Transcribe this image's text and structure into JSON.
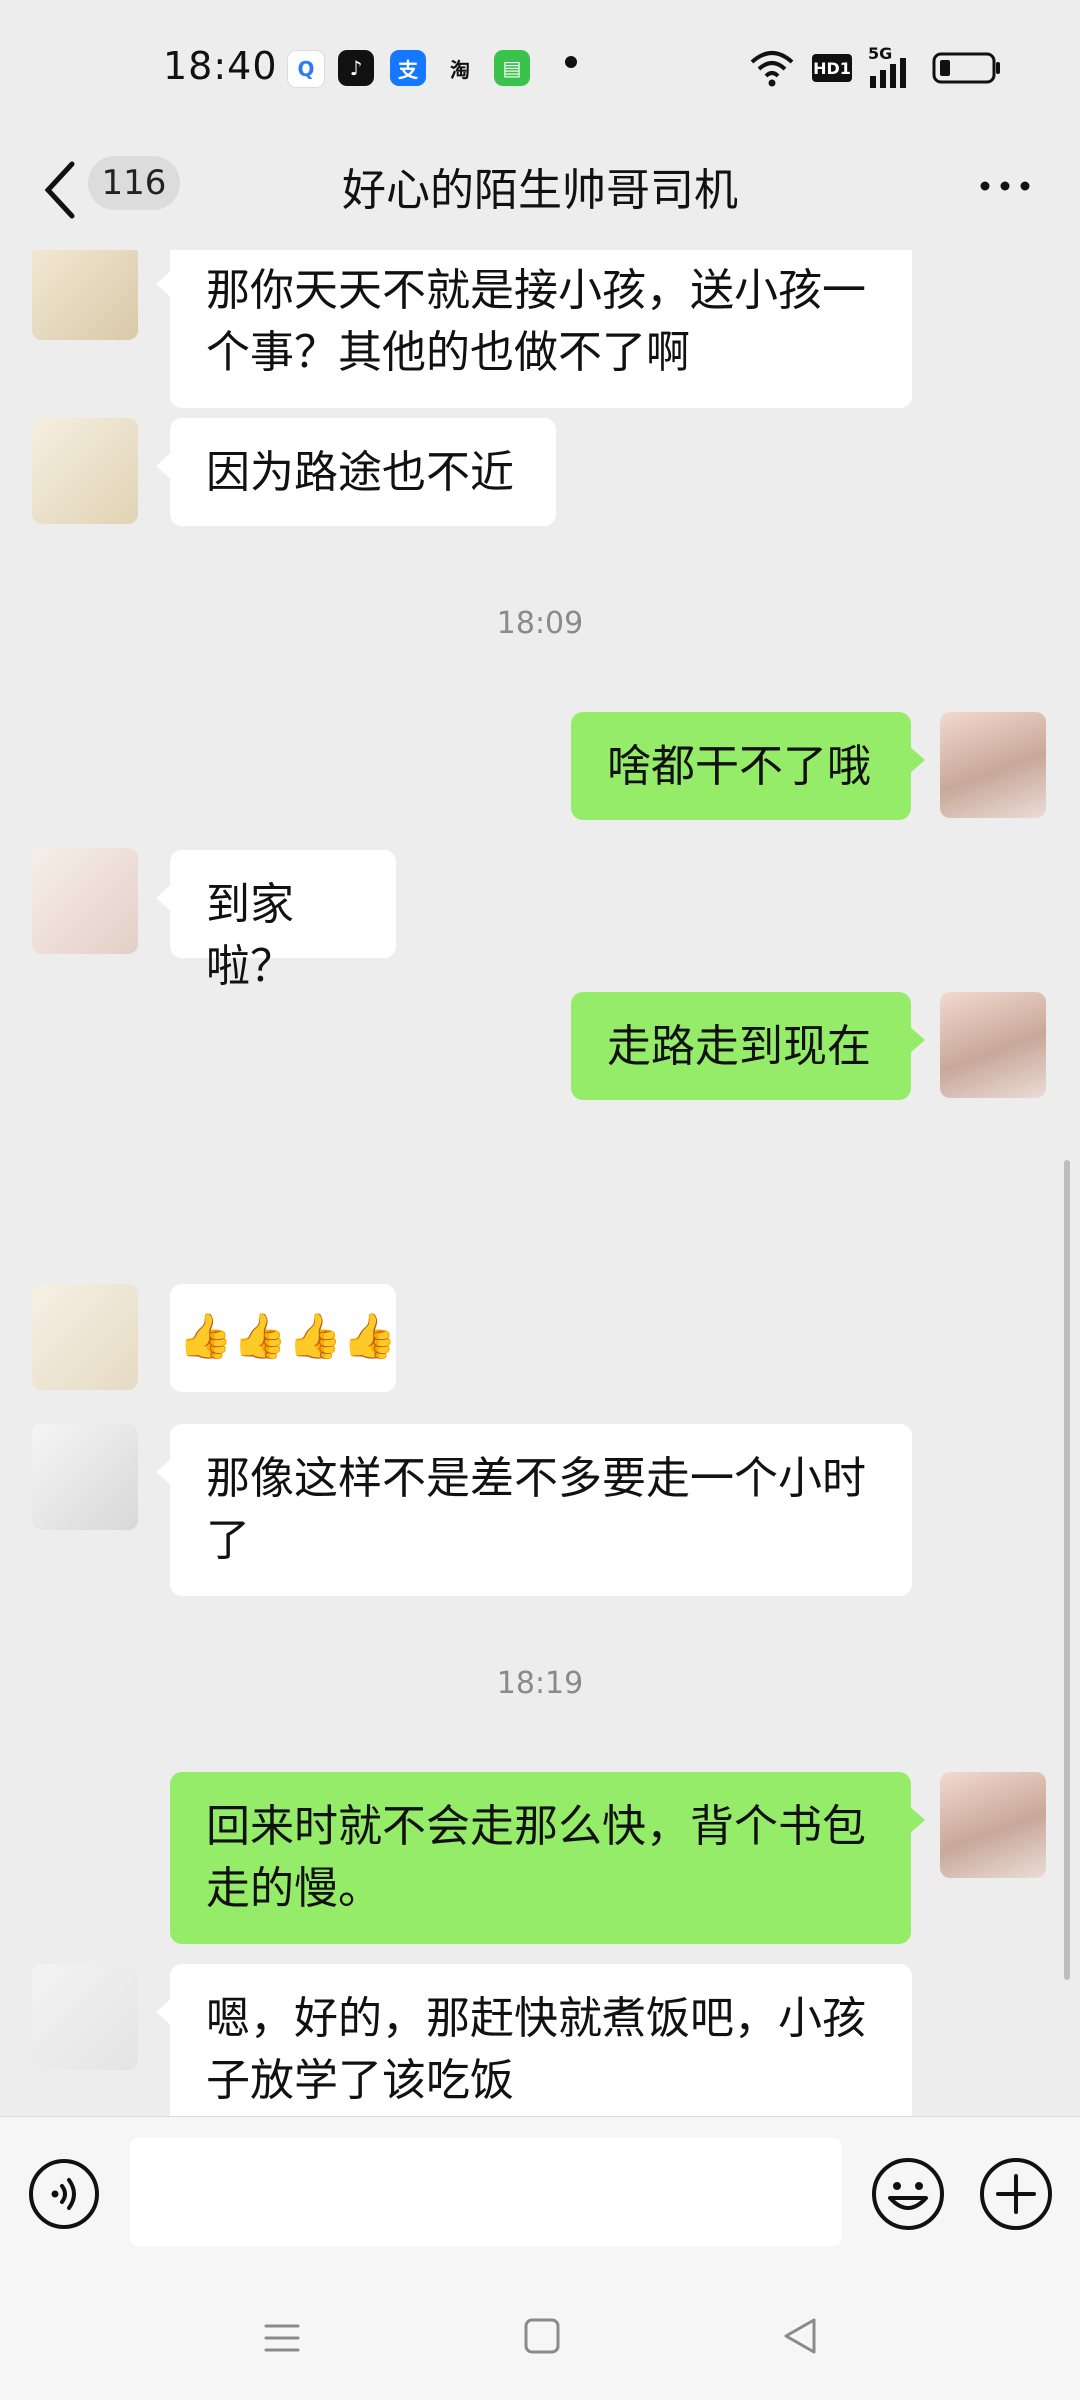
{
  "status": {
    "time": "18:40",
    "app_icons": [
      {
        "name": "search-app-icon",
        "glyph": "Q",
        "color": "#2f7bf6"
      },
      {
        "name": "tiktok-icon",
        "glyph": "♪",
        "color": "#111111"
      },
      {
        "name": "alipay-icon",
        "glyph": "支",
        "color": "#1677ff"
      },
      {
        "name": "taobao-icon",
        "glyph": "淘",
        "color": "#ff5000"
      },
      {
        "name": "message-app-icon",
        "glyph": "▤",
        "color": "#3ac34c"
      }
    ],
    "hd_label": "HD1",
    "network_label": "5G"
  },
  "nav": {
    "back_count": "116",
    "title": "好心的陌生帅哥司机"
  },
  "messages": [
    {
      "side": "in",
      "text": "那你天天不就是接小孩，送小孩一个事？其他的也做不了啊"
    },
    {
      "side": "in",
      "text": "因为路途也不近"
    },
    {
      "timestamp": "18:09"
    },
    {
      "side": "out",
      "text": "啥都干不了哦"
    },
    {
      "side": "in",
      "text": "到家啦？"
    },
    {
      "side": "out",
      "text": "走路走到现在"
    },
    {
      "side": "in",
      "text": "👍👍👍👍"
    },
    {
      "side": "in",
      "text": "那像这样不是差不多要走一个小时了"
    },
    {
      "timestamp": "18:19"
    },
    {
      "side": "out",
      "text": "回来时就不会走那么快，背个书包走的慢。"
    },
    {
      "side": "in",
      "text": "嗯，好的，那赶快就煮饭吧，小孩子放学了该吃饭"
    }
  ],
  "colors": {
    "background": "#ededed",
    "incoming_bubble": "#ffffff",
    "outgoing_bubble": "#95ec69"
  }
}
